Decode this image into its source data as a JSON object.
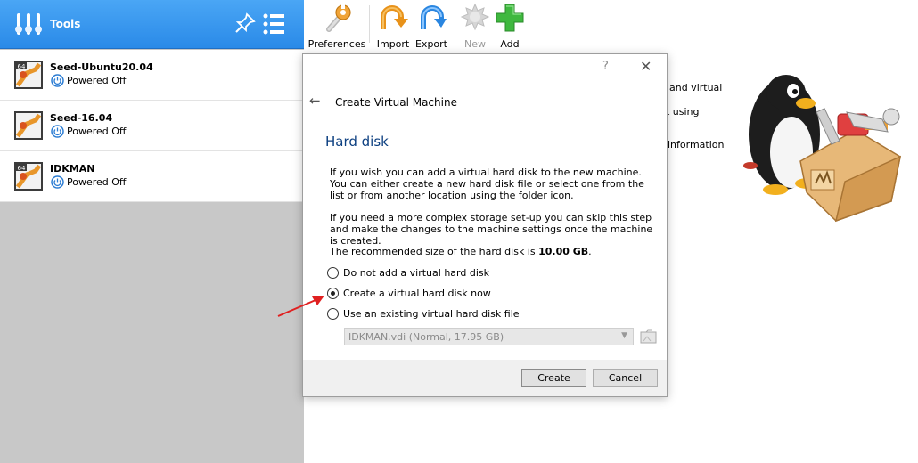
{
  "sidebar": {
    "header": {
      "label": "Tools"
    },
    "vms": [
      {
        "name": "Seed-Ubuntu20.04",
        "status": "Powered Off",
        "os_badge": "64"
      },
      {
        "name": "Seed-16.04",
        "status": "Powered Off",
        "os_badge": ""
      },
      {
        "name": "IDKMAN",
        "status": "Powered Off",
        "os_badge": "64"
      }
    ]
  },
  "toolbar": {
    "preferences": "Preferences",
    "import": "Import",
    "export": "Export",
    "new": "New",
    "add": "Add"
  },
  "background": {
    "line1": "es and virtual",
    "line2": "nt using",
    "line3": "information"
  },
  "dialog": {
    "help": "?",
    "close": "✕",
    "back": "←",
    "title": "Create Virtual Machine",
    "heading": "Hard disk",
    "para1": "If you wish you can add a virtual hard disk to the new machine. You can either create a new hard disk file or select one from the list or from another location using the folder icon.",
    "para2": "If you need a more complex storage set-up you can skip this step and make the changes to the machine settings once the machine is created.",
    "recommended_prefix": "The recommended size of the hard disk is ",
    "recommended_size": "10.00 GB",
    "recommended_suffix": ".",
    "options": [
      {
        "label": "Do not add a virtual hard disk",
        "checked": false
      },
      {
        "label": "Create a virtual hard disk now",
        "checked": true
      },
      {
        "label": "Use an existing virtual hard disk file",
        "checked": false
      }
    ],
    "disk_select_value": "IDKMAN.vdi (Normal, 17.95 GB)",
    "create_button": "Create",
    "cancel_button": "Cancel"
  },
  "colors": {
    "header_blue": "#2a8ae8",
    "heading_blue": "#0c3f80",
    "annotation_red": "#e02020"
  }
}
